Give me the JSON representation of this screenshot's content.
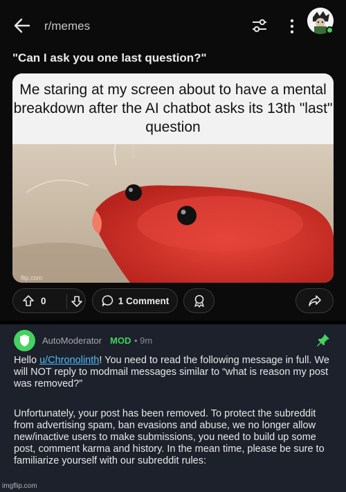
{
  "header": {
    "subreddit": "r/memes",
    "icons": [
      "back-arrow-icon",
      "filter-icon",
      "more-vertical-icon",
      "avatar"
    ]
  },
  "post": {
    "title": "\"Can I ask you one last question?\"",
    "meme_caption": "Me staring at my screen about to have a mental breakdown after the AI chatbot asks its 13th \"last\" question",
    "image_credit": "flip.com",
    "vote_count": "0",
    "comment_label": "1 Comment"
  },
  "comment": {
    "author": "AutoModerator",
    "badge": "MOD",
    "time": "• 9m",
    "p1_before": "Hello ",
    "p1_link": "u/Chronolinth",
    "p1_after": "! You need to read the following message in full. We will NOT reply to modmail messages similar to “what is reason my post was removed?”",
    "p2": "Unfortunately, your post has been removed. To protect the subreddit from advertising spam, ban evasions and abuse, we no longer allow new/inactive users to make submissions, you need to build up some post, comment karma and history. In the mean time, please be sure to familiarize yourself with our subreddit rules:"
  },
  "watermark": "imgflip.com",
  "colors": {
    "background": "#0b0b0b",
    "comment_bg": "#1c212b",
    "mod_green": "#46d160",
    "link_blue": "#4fbdf8"
  }
}
